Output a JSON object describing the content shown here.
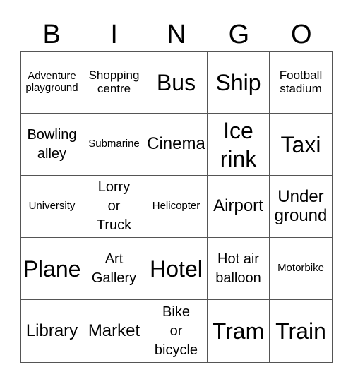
{
  "header": {
    "letters": [
      "B",
      "I",
      "N",
      "G",
      "O"
    ]
  },
  "cells": [
    {
      "text": "Adventure\nplayground",
      "size": "s-xs"
    },
    {
      "text": "Shopping\ncentre",
      "size": "s-sm"
    },
    {
      "text": "Bus",
      "size": "s-xl"
    },
    {
      "text": "Ship",
      "size": "s-xl"
    },
    {
      "text": "Football\nstadium",
      "size": "s-sm"
    },
    {
      "text": "Bowling\nalley",
      "size": "s-md"
    },
    {
      "text": "Submarine",
      "size": "s-xs"
    },
    {
      "text": "Cinema",
      "size": "s-lg"
    },
    {
      "text": "Ice\nrink",
      "size": "s-xl"
    },
    {
      "text": "Taxi",
      "size": "s-xl"
    },
    {
      "text": "University",
      "size": "s-xs"
    },
    {
      "text": "Lorry\nor\nTruck",
      "size": "s-md"
    },
    {
      "text": "Helicopter",
      "size": "s-xs"
    },
    {
      "text": "Airport",
      "size": "s-lg"
    },
    {
      "text": "Under\nground",
      "size": "s-lg"
    },
    {
      "text": "Plane",
      "size": "s-xl"
    },
    {
      "text": "Art\nGallery",
      "size": "s-md"
    },
    {
      "text": "Hotel",
      "size": "s-xl"
    },
    {
      "text": "Hot air\nballoon",
      "size": "s-md"
    },
    {
      "text": "Motorbike",
      "size": "s-xs"
    },
    {
      "text": "Library",
      "size": "s-lg"
    },
    {
      "text": "Market",
      "size": "s-lg"
    },
    {
      "text": "Bike\nor\nbicycle",
      "size": "s-md"
    },
    {
      "text": "Tram",
      "size": "s-xl"
    },
    {
      "text": "Train",
      "size": "s-xl"
    }
  ]
}
